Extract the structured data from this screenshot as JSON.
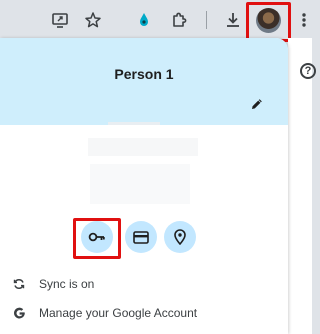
{
  "toolbar": {
    "icons": [
      "screen-share-icon",
      "star-icon",
      "extension-drop-icon",
      "puzzle-icon",
      "download-icon",
      "profile-avatar",
      "more-vert-icon"
    ]
  },
  "profile_menu": {
    "name": "Person 1",
    "edit_icon": "pencil-icon",
    "quick_actions": [
      "key-icon",
      "credit-card-icon",
      "location-pin-icon"
    ],
    "rows": [
      {
        "icon": "sync-icon",
        "label": "Sync is on"
      },
      {
        "icon": "google-g-icon",
        "label": "Manage your Google Account"
      }
    ]
  },
  "page": {
    "help_icon_text": "?"
  },
  "colors": {
    "toolbar_bg": "#dfe3e8",
    "header_bg": "#cfeefc",
    "quick_action_bg": "#c2e7ff",
    "highlight": "#e01010",
    "accent_teal": "#00aac8"
  }
}
